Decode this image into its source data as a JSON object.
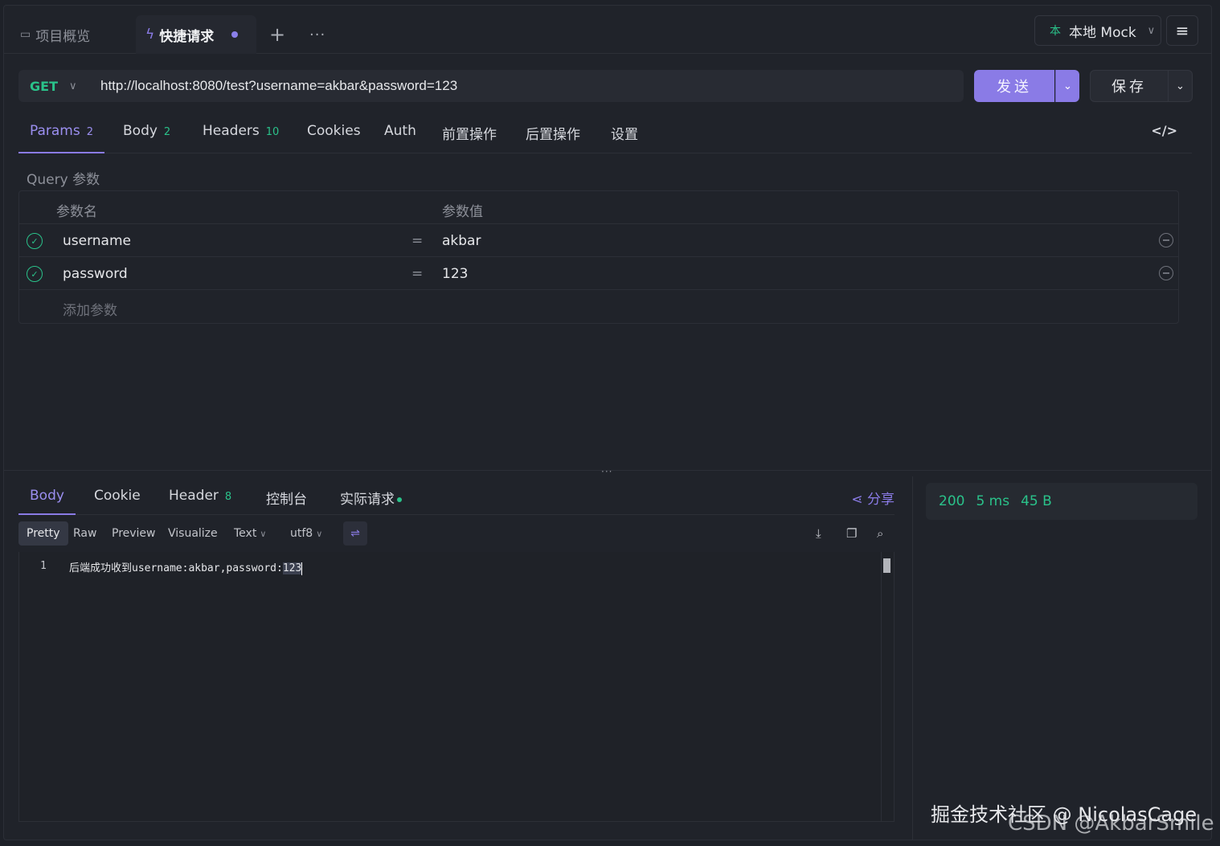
{
  "tabs": {
    "overview_label": "项目概览",
    "quick_label": "快捷请求",
    "add_symbol": "+",
    "more_symbol": "···"
  },
  "env": {
    "badge": "本",
    "label": "本地 Mock"
  },
  "request": {
    "method": "GET",
    "url": "http://localhost:8080/test?username=akbar&password=123",
    "send_label": "发送",
    "save_label": "保存"
  },
  "req_tabs": [
    {
      "label": "Params",
      "count": "2"
    },
    {
      "label": "Body",
      "count": "2"
    },
    {
      "label": "Headers",
      "count": "10"
    },
    {
      "label": "Cookies",
      "count": ""
    },
    {
      "label": "Auth",
      "count": ""
    },
    {
      "label": "前置操作",
      "count": ""
    },
    {
      "label": "后置操作",
      "count": ""
    },
    {
      "label": "设置",
      "count": ""
    }
  ],
  "params": {
    "section_label": "Query 参数",
    "header_name": "参数名",
    "header_value": "参数值",
    "rows": [
      {
        "name": "username",
        "eq": "=",
        "value": "akbar"
      },
      {
        "name": "password",
        "eq": "=",
        "value": "123"
      }
    ],
    "add_placeholder": "添加参数"
  },
  "response": {
    "tabs": [
      {
        "label": "Body",
        "count": ""
      },
      {
        "label": "Cookie",
        "count": ""
      },
      {
        "label": "Header",
        "count": "8"
      },
      {
        "label": "控制台",
        "count": ""
      },
      {
        "label": "实际请求",
        "count": ""
      }
    ],
    "share_label": "分享",
    "formats": [
      "Pretty",
      "Raw",
      "Preview",
      "Visualize"
    ],
    "type_label": "Text",
    "encoding_label": "utf8",
    "line_number": "1",
    "body_prefix": "后端成功收到username:akbar,password:",
    "body_selected": "123",
    "status_code": "200",
    "time": "5 ms",
    "size": "45 B"
  },
  "watermark": {
    "line1": "掘金技术社区 @ NicolasCage",
    "line2": "CSDN @AkbarSmile"
  },
  "colors": {
    "accent": "#8a7be6",
    "success": "#2ac28a",
    "background": "#20232a"
  }
}
